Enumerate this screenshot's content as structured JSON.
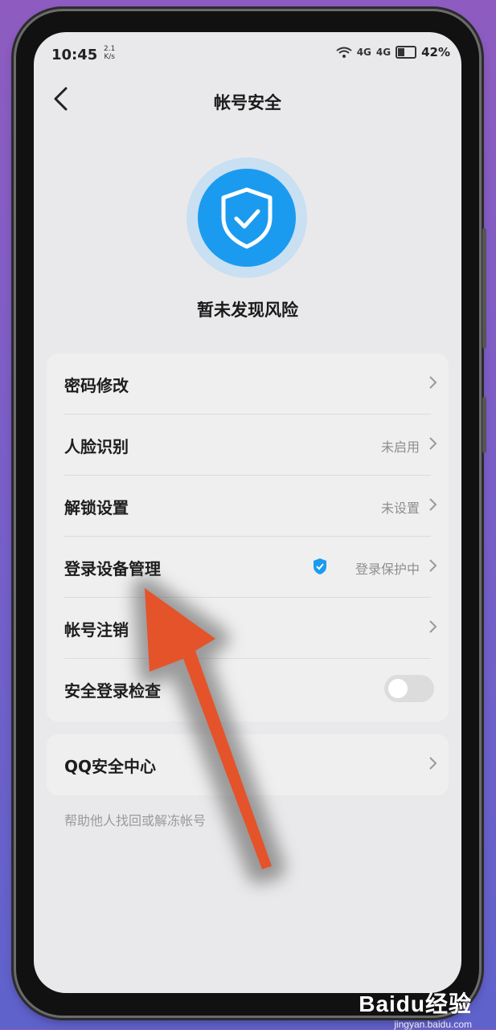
{
  "status_bar": {
    "time": "10:45",
    "speed_value": "2.1",
    "speed_unit": "K/s",
    "signal1": "4G",
    "signal2": "4G",
    "battery": "42%"
  },
  "nav": {
    "title": "帐号安全"
  },
  "security_status": {
    "text": "暂未发现风险"
  },
  "settings": [
    {
      "label": "密码修改",
      "value": ""
    },
    {
      "label": "人脸识别",
      "value": "未启用"
    },
    {
      "label": "解锁设置",
      "value": "未设置"
    },
    {
      "label": "登录设备管理",
      "value": "登录保护中"
    },
    {
      "label": "帐号注销",
      "value": ""
    },
    {
      "label": "安全登录检查",
      "value": ""
    }
  ],
  "qq_center": {
    "label": "QQ安全中心",
    "footnote": "帮助他人找回或解冻帐号"
  },
  "colors": {
    "accent": "#1a9bf0",
    "arrow": "#e5532b"
  },
  "watermark": {
    "logo": "Baidu经验",
    "url": "jingyan.baidu.com"
  }
}
